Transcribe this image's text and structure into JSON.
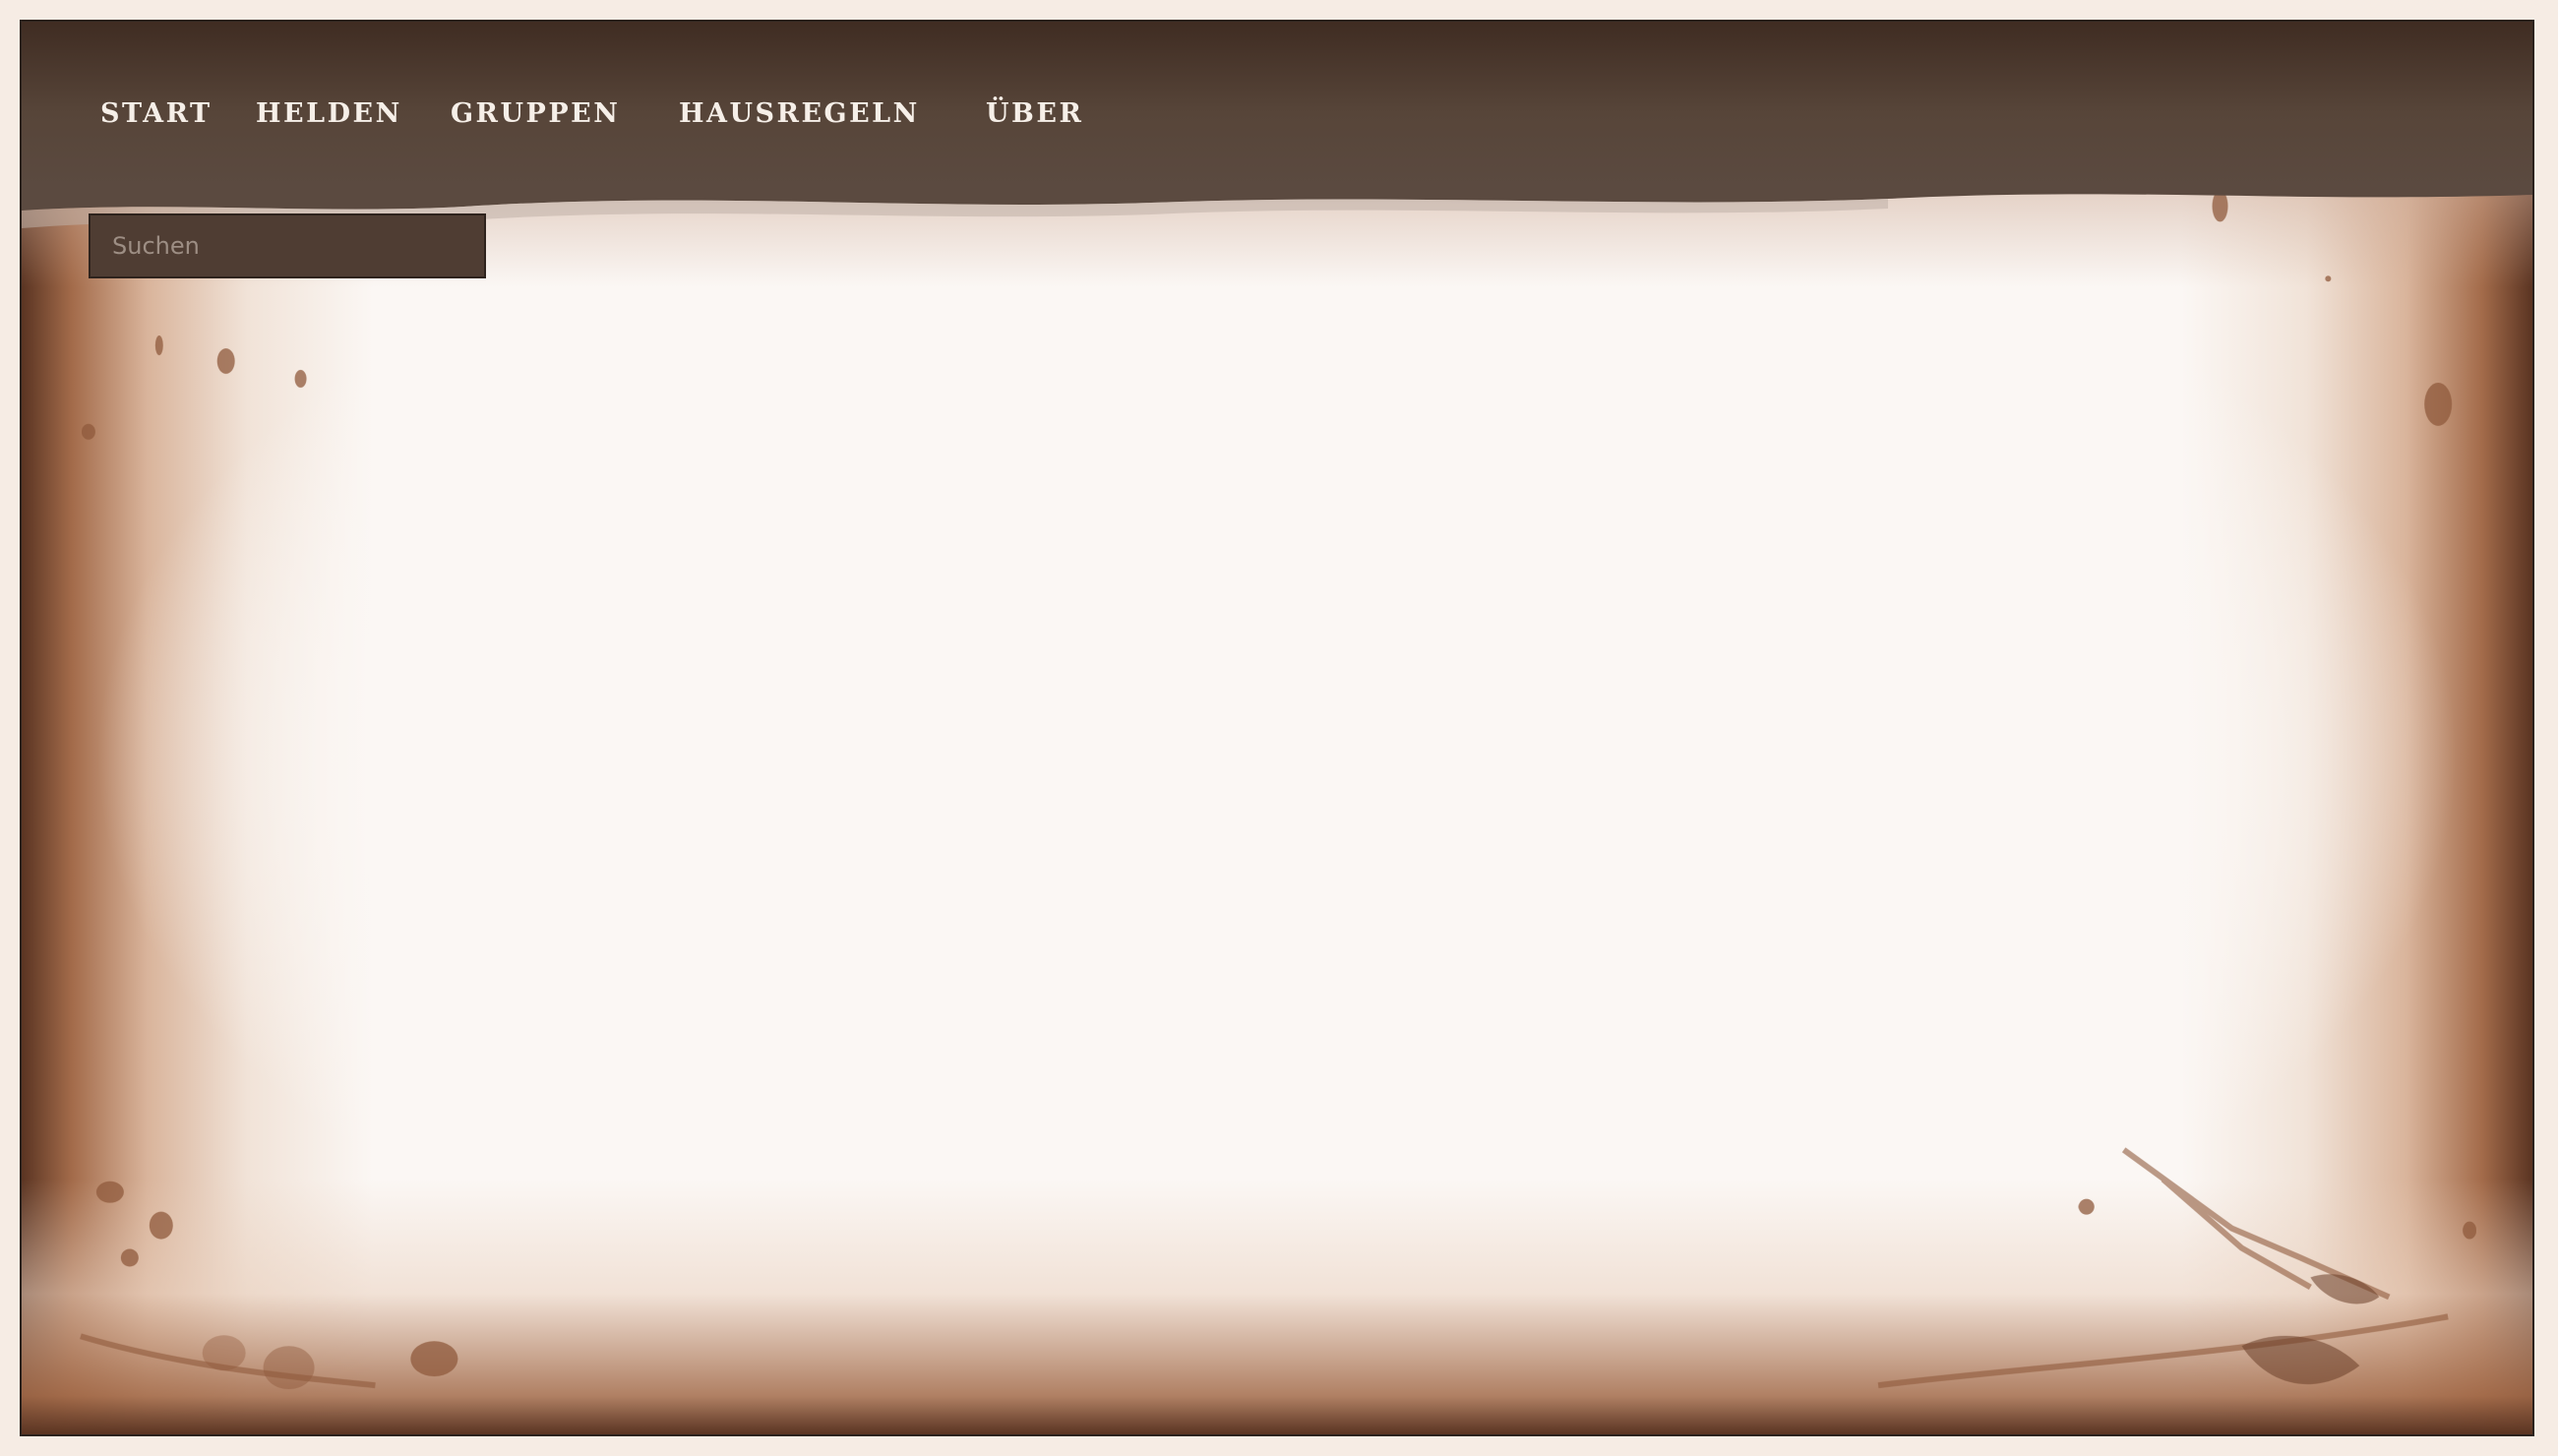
{
  "nav": {
    "items": [
      {
        "label": "START"
      },
      {
        "label": "HELDEN"
      },
      {
        "label": "GRUPPEN"
      },
      {
        "label": "HAUSREGELN"
      },
      {
        "label": "ÜBER"
      }
    ]
  },
  "search": {
    "placeholder": "Suchen",
    "value": ""
  },
  "colors": {
    "navbar": "#574539",
    "border_brown": "#a36b4a",
    "paper": "#fbf7f4",
    "nav_text": "#f6efe8"
  }
}
